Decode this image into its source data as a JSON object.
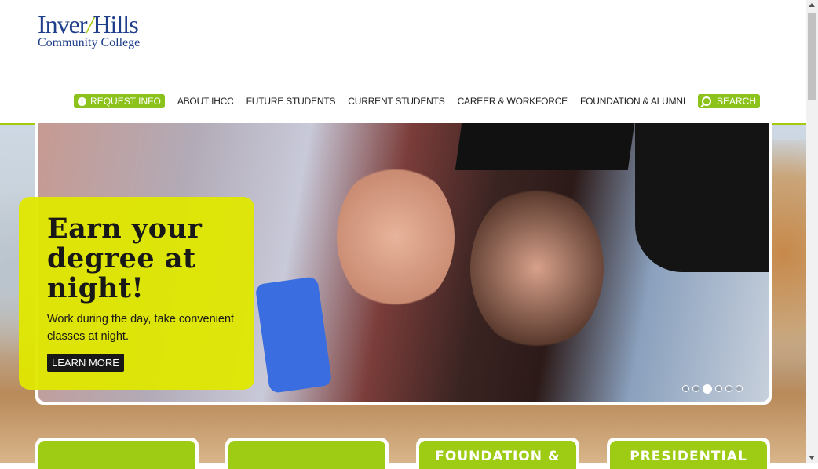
{
  "logo": {
    "line1_a": "Inver",
    "line1_b": "Hills",
    "line2": "Community College"
  },
  "nav": {
    "request_info": "REQUEST INFO",
    "items": [
      "ABOUT IHCC",
      "FUTURE STUDENTS",
      "CURRENT STUDENTS",
      "CAREER & WORKFORCE",
      "FOUNDATION & ALUMNI"
    ],
    "search": "SEARCH"
  },
  "hero": {
    "headline": "Earn your degree at night!",
    "body": "Work during the day, take convenient classes at night.",
    "button": "LEARN MORE",
    "slide_count": 6,
    "active_slide": 3
  },
  "cards": [
    "",
    "",
    "FOUNDATION &",
    "PRESIDENTIAL"
  ],
  "colors": {
    "brand_green": "#8bc21c",
    "callout_yellow": "#e0e800",
    "logo_blue": "#1f3f8a"
  }
}
